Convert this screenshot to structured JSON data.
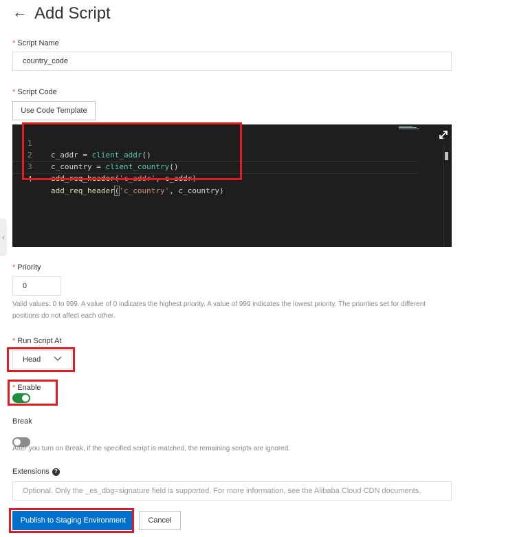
{
  "header": {
    "back_icon": "arrow-left-icon",
    "title": "Add Script"
  },
  "script_name": {
    "label": "Script Name",
    "required_mark": "*",
    "value": "country_code"
  },
  "script_code": {
    "label": "Script Code",
    "required_mark": "*",
    "template_button": "Use Code Template",
    "expand_icon": "expand-arrows-icon",
    "line_numbers": [
      "1",
      "2",
      "3",
      "4"
    ],
    "lines": [
      {
        "var": "c_addr",
        "op": " = ",
        "fn": "client_addr",
        "tail": "()"
      },
      {
        "var": "c_country",
        "op": " = ",
        "fn": "client_country",
        "tail": "()"
      },
      {
        "fn": "add_req_header",
        "open": "(",
        "str": "'c_addr'",
        "rest": ", c_addr)"
      },
      {
        "fn": "add_req_header",
        "open": "(",
        "str": "'c_country'",
        "rest": ", c_country)"
      }
    ]
  },
  "priority": {
    "label": "Priority",
    "required_mark": "*",
    "value": "0",
    "hint": "Valid values: 0 to 999. A value of 0 indicates the highest priority. A value of 999 indicates the lowest priority. The priorities set for different positions do not affect each other."
  },
  "run_script_at": {
    "label": "Run Script At",
    "required_mark": "*",
    "value": "Head",
    "icon": "chevron-down-icon"
  },
  "enable": {
    "label": "Enable",
    "required_mark": "*",
    "on": true,
    "color": "#1e8e3e"
  },
  "break": {
    "label": "Break",
    "on": false,
    "color": "#8c8c8c",
    "hint": "After you turn on Break, if the specified script is matched, the remaining scripts are ignored."
  },
  "extensions": {
    "label": "Extensions",
    "help_icon": "question-circle-icon",
    "help_glyph": "?",
    "placeholder": "Optional. Only the _es_dbg=signature field is supported. For more information, see the Alibaba Cloud CDN documents."
  },
  "actions": {
    "publish": "Publish to Staging Environment",
    "cancel": "Cancel"
  },
  "side_tab": {
    "icon": "chevron-left-icon",
    "glyph": "‹"
  },
  "colors": {
    "primary": "#0070cc",
    "highlight": "#e11b22",
    "editor_bg": "#1e1e1e"
  }
}
